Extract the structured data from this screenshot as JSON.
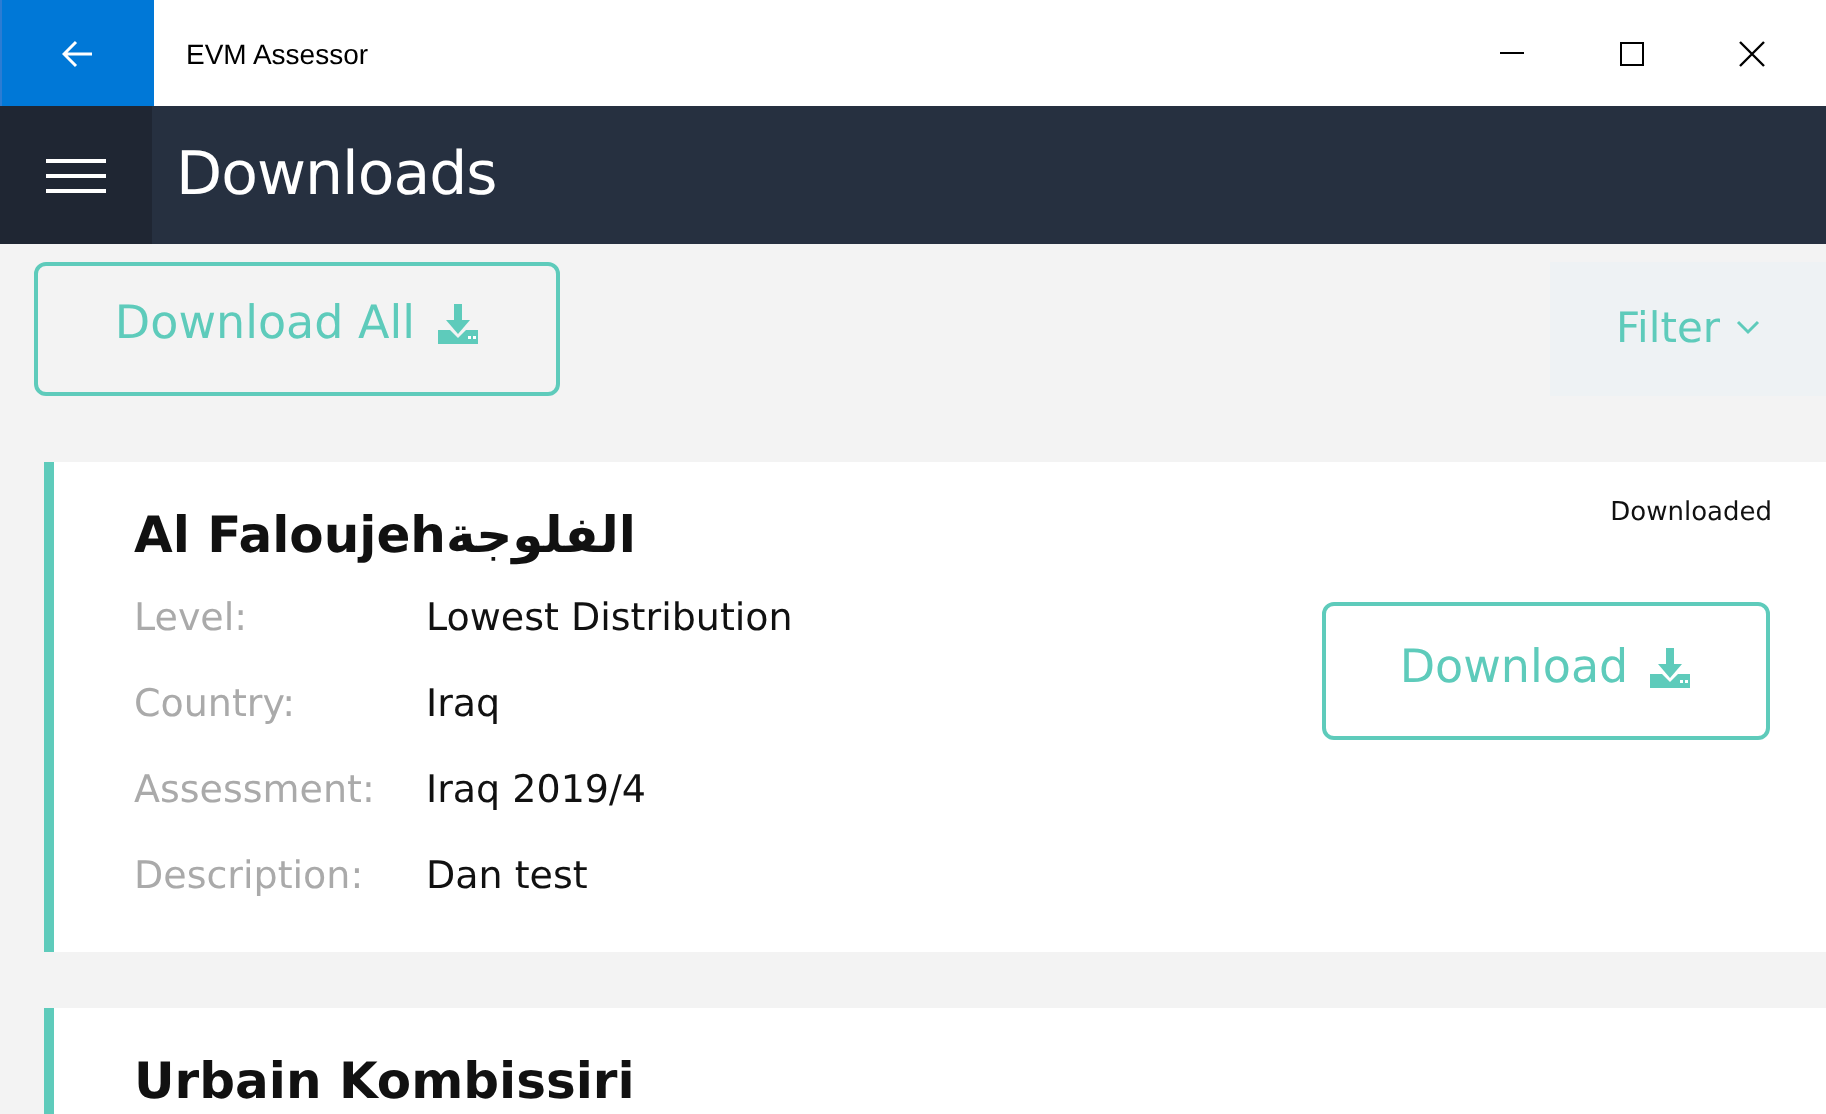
{
  "window": {
    "title": "EVM Assessor"
  },
  "header": {
    "title": "Downloads"
  },
  "toolbar": {
    "download_all": "Download All",
    "filter": "Filter"
  },
  "cards": [
    {
      "title": "Al Faloujehالفلوجة",
      "status": "Downloaded",
      "button": "Download",
      "fields": [
        {
          "label": "Level:",
          "value": "Lowest Distribution"
        },
        {
          "label": "Country:",
          "value": "Iraq"
        },
        {
          "label": "Assessment:",
          "value": "Iraq 2019/4"
        },
        {
          "label": "Description:",
          "value": "Dan test"
        }
      ]
    },
    {
      "title": "Urbain Kombissiri"
    }
  ]
}
